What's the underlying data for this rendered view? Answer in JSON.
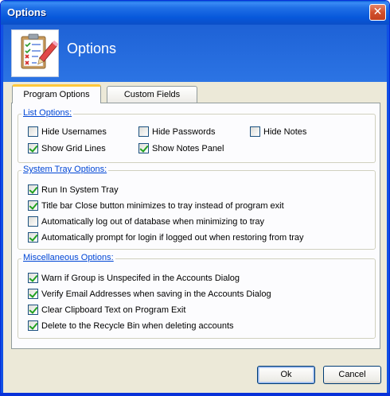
{
  "window": {
    "title": "Options",
    "close_symbol": "✕"
  },
  "header": {
    "title": "Options",
    "icon": "clipboard-checklist-pencil-icon"
  },
  "tabs": [
    {
      "label": "Program Options",
      "active": true
    },
    {
      "label": "Custom Fields",
      "active": false
    }
  ],
  "groups": {
    "list": {
      "legend": "List Options:",
      "items": [
        {
          "label": "Hide Usernames",
          "checked": false
        },
        {
          "label": "Hide Passwords",
          "checked": false
        },
        {
          "label": "Hide Notes",
          "checked": false
        },
        {
          "label": "Show Grid Lines",
          "checked": true
        },
        {
          "label": "Show Notes Panel",
          "checked": true
        }
      ]
    },
    "tray": {
      "legend": "System Tray Options:",
      "items": [
        {
          "label": "Run In System Tray",
          "checked": true
        },
        {
          "label": "Title bar Close button minimizes to tray instead of program exit",
          "checked": true
        },
        {
          "label": "Automatically log out of database when minimizing to tray",
          "checked": false
        },
        {
          "label": "Automatically prompt for login if logged out when restoring from tray",
          "checked": true
        }
      ]
    },
    "misc": {
      "legend": "Miscellaneous Options:",
      "items": [
        {
          "label": "Warn if Group is Unspecifed in the Accounts Dialog",
          "checked": true
        },
        {
          "label": "Verify Email Addresses when saving in the Accounts Dialog",
          "checked": true
        },
        {
          "label": "Clear Clipboard Text on Program Exit",
          "checked": true
        },
        {
          "label": "Delete to the Recycle Bin when deleting accounts",
          "checked": true
        }
      ]
    }
  },
  "buttons": {
    "ok": "Ok",
    "cancel": "Cancel"
  },
  "colors": {
    "titlebar": "#0758db",
    "header": "#2c74e4",
    "legend": "#0046d5",
    "check": "#21a121",
    "active_tab_accent": "#ffc83c"
  }
}
